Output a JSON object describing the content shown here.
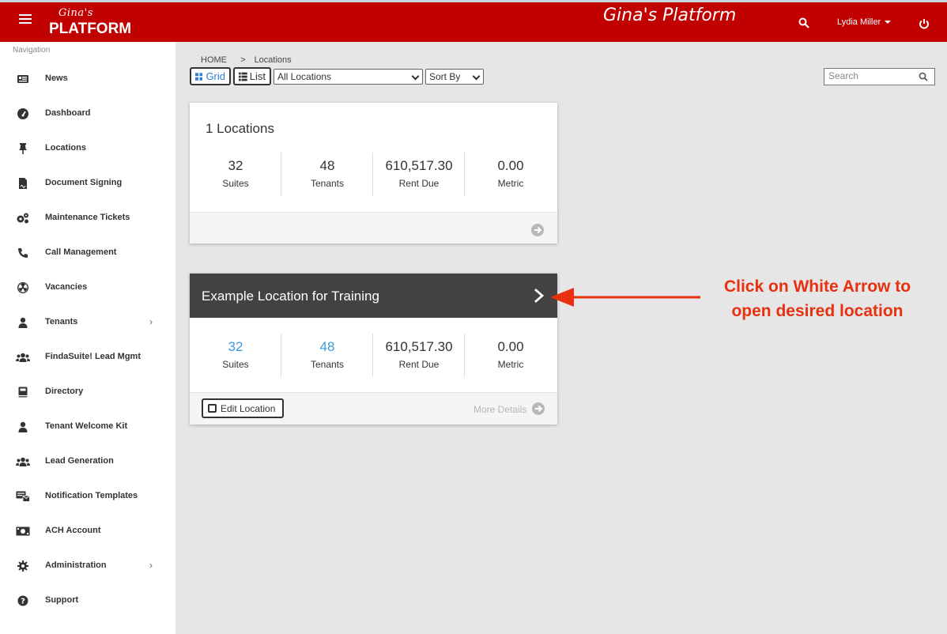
{
  "header": {
    "logo_script": "Gina's",
    "logo_brand": "PLATFORM",
    "app_title": "Gina's Platform",
    "user_name": "Lydia Miller",
    "brand_color": "#c10000"
  },
  "sidebar": {
    "heading": "Navigation",
    "items": [
      {
        "label": "News",
        "icon": "newspaper-icon"
      },
      {
        "label": "Dashboard",
        "icon": "gauge-icon"
      },
      {
        "label": "Locations",
        "icon": "thumbtack-icon"
      },
      {
        "label": "Document Signing",
        "icon": "file-signature-icon"
      },
      {
        "label": "Maintenance Tickets",
        "icon": "cogs-icon"
      },
      {
        "label": "Call Management",
        "icon": "phone-icon"
      },
      {
        "label": "Vacancies",
        "icon": "radiation-icon"
      },
      {
        "label": "Tenants",
        "icon": "user-icon"
      },
      {
        "label": "FindaSuite! Lead Mgmt",
        "icon": "users-icon"
      },
      {
        "label": "Directory",
        "icon": "book-icon"
      },
      {
        "label": "Tenant Welcome Kit",
        "icon": "user-icon"
      },
      {
        "label": "Lead Generation",
        "icon": "users-icon"
      },
      {
        "label": "Notification Templates",
        "icon": "mail-bulk-icon"
      },
      {
        "label": "ACH Account",
        "icon": "money-bill-icon"
      },
      {
        "label": "Administration",
        "icon": "cog-icon"
      },
      {
        "label": "Support",
        "icon": "question-circle-icon"
      }
    ]
  },
  "breadcrumb": {
    "home": "HOME",
    "sep": ">",
    "current": "Locations"
  },
  "toolbar": {
    "grid_label": "Grid",
    "list_label": "List",
    "location_select": "All Locations",
    "sort_select": "Sort By",
    "search_placeholder": "Search"
  },
  "summary_card": {
    "title": "1 Locations",
    "stats": [
      {
        "value": "32",
        "label": "Suites"
      },
      {
        "value": "48",
        "label": "Tenants"
      },
      {
        "value": "610,517.30",
        "label": "Rent Due"
      },
      {
        "value": "0.00",
        "label": "Metric"
      }
    ]
  },
  "location_card": {
    "title": "Example Location for Training",
    "stats": [
      {
        "value": "32",
        "label": "Suites"
      },
      {
        "value": "48",
        "label": "Tenants"
      },
      {
        "value": "610,517.30",
        "label": "Rent Due"
      },
      {
        "value": "0.00",
        "label": "Metric"
      }
    ],
    "edit_label": "Edit Location",
    "more_label": "More Details"
  },
  "annotation": {
    "line1": "Click on White Arrow to",
    "line2": "open desired location",
    "color": "#e83010"
  }
}
